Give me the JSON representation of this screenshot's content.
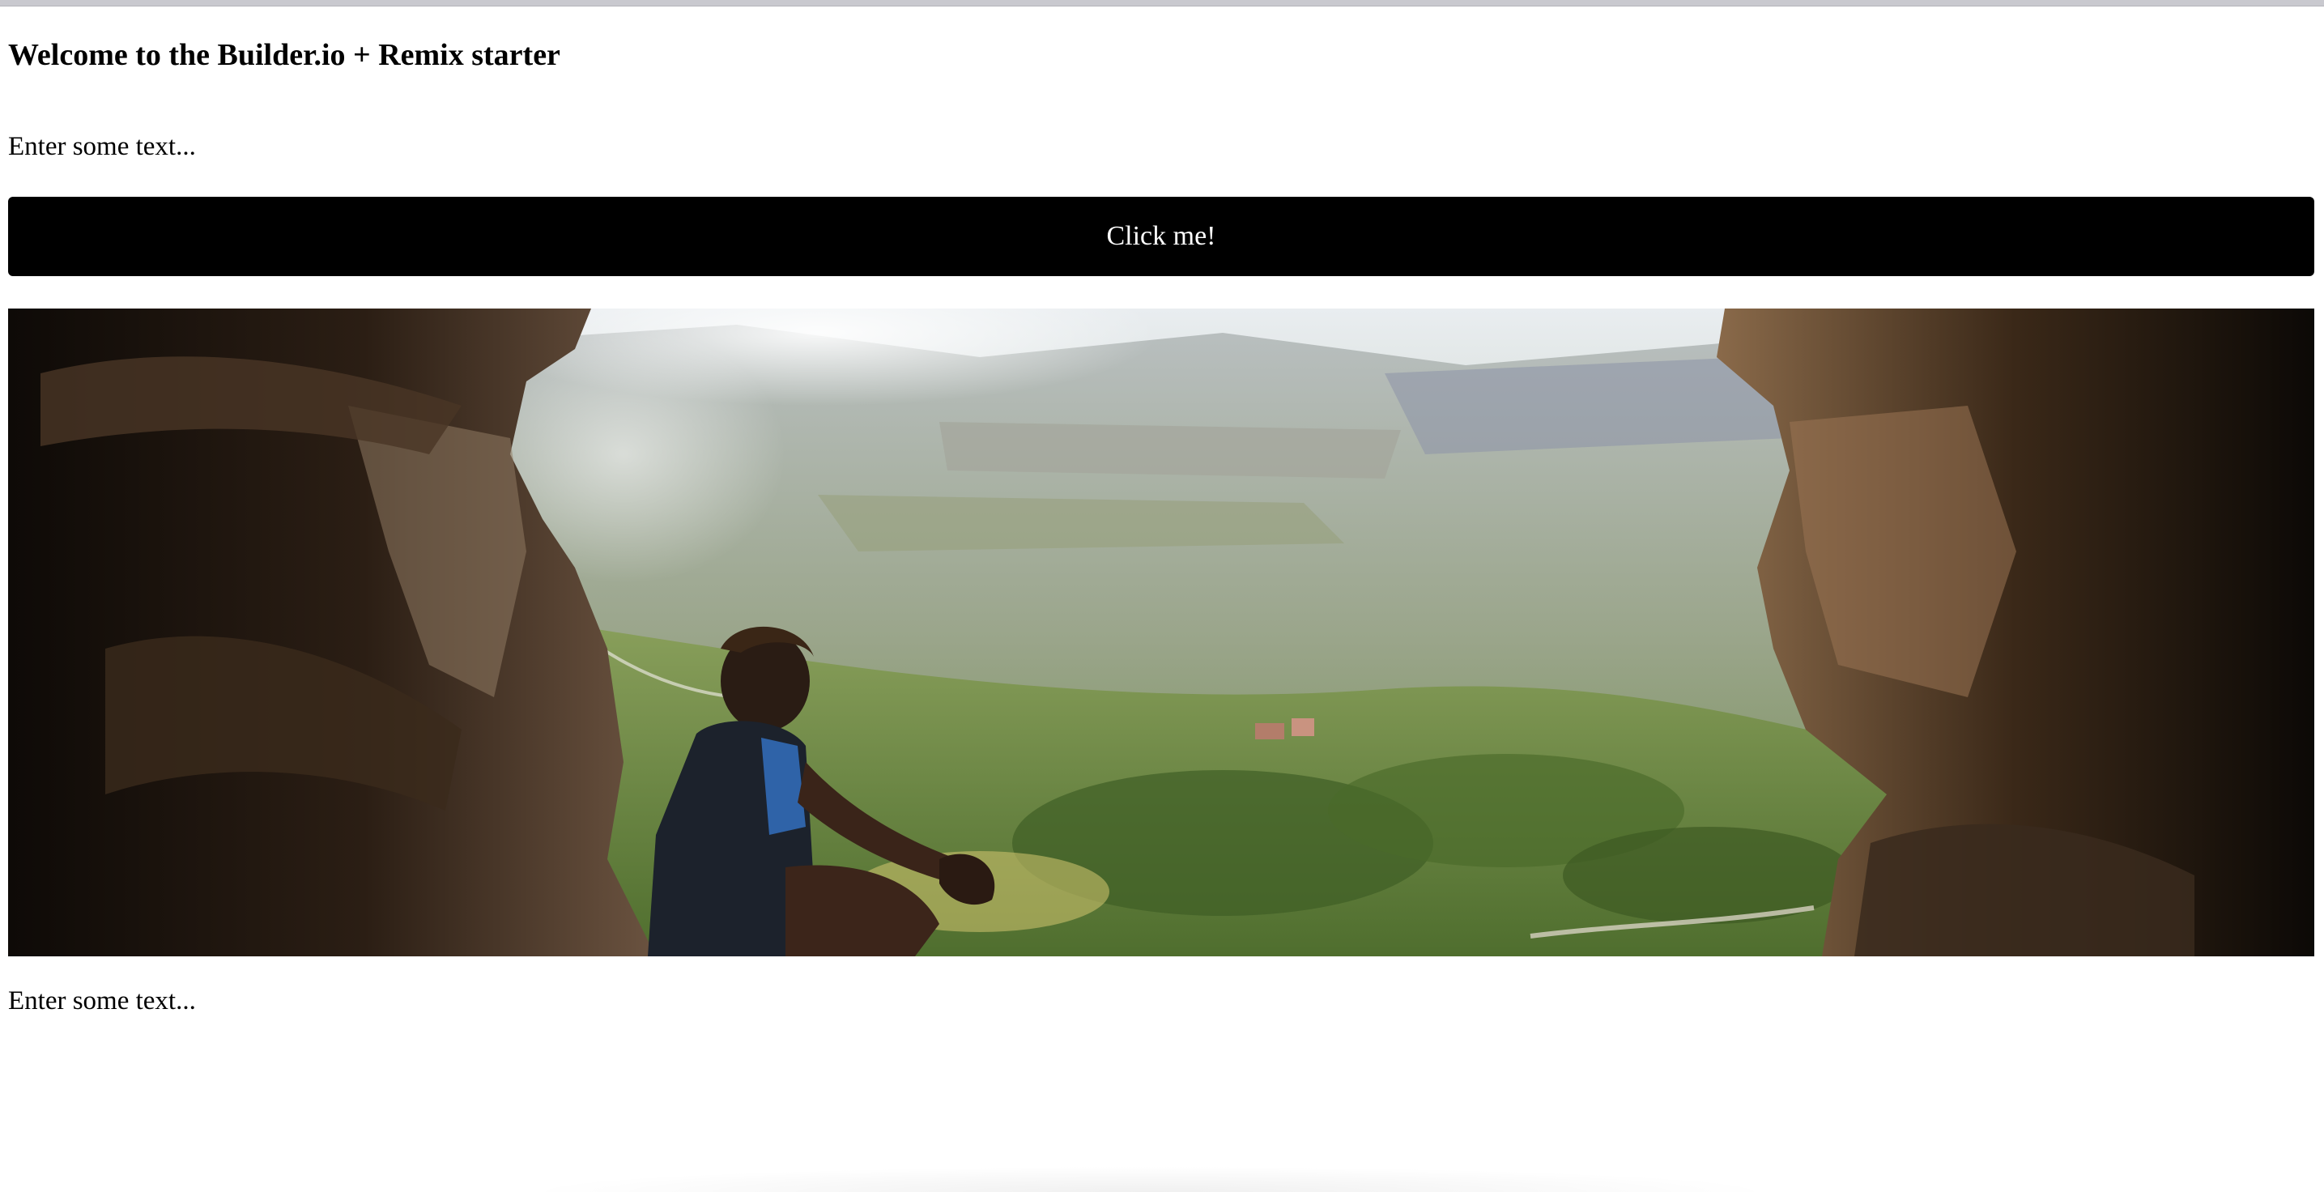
{
  "header": {
    "title": "Welcome to the Builder.io + Remix starter"
  },
  "content": {
    "text_top": "Enter some text...",
    "button_label": "Click me!",
    "image": {
      "alt_name": "hero-image",
      "subject": "person sitting in cave overlooking mountain valley"
    },
    "text_bottom": "Enter some text..."
  },
  "colors": {
    "button_bg": "#000000",
    "button_text": "#ffffff",
    "page_bg": "#ffffff"
  }
}
